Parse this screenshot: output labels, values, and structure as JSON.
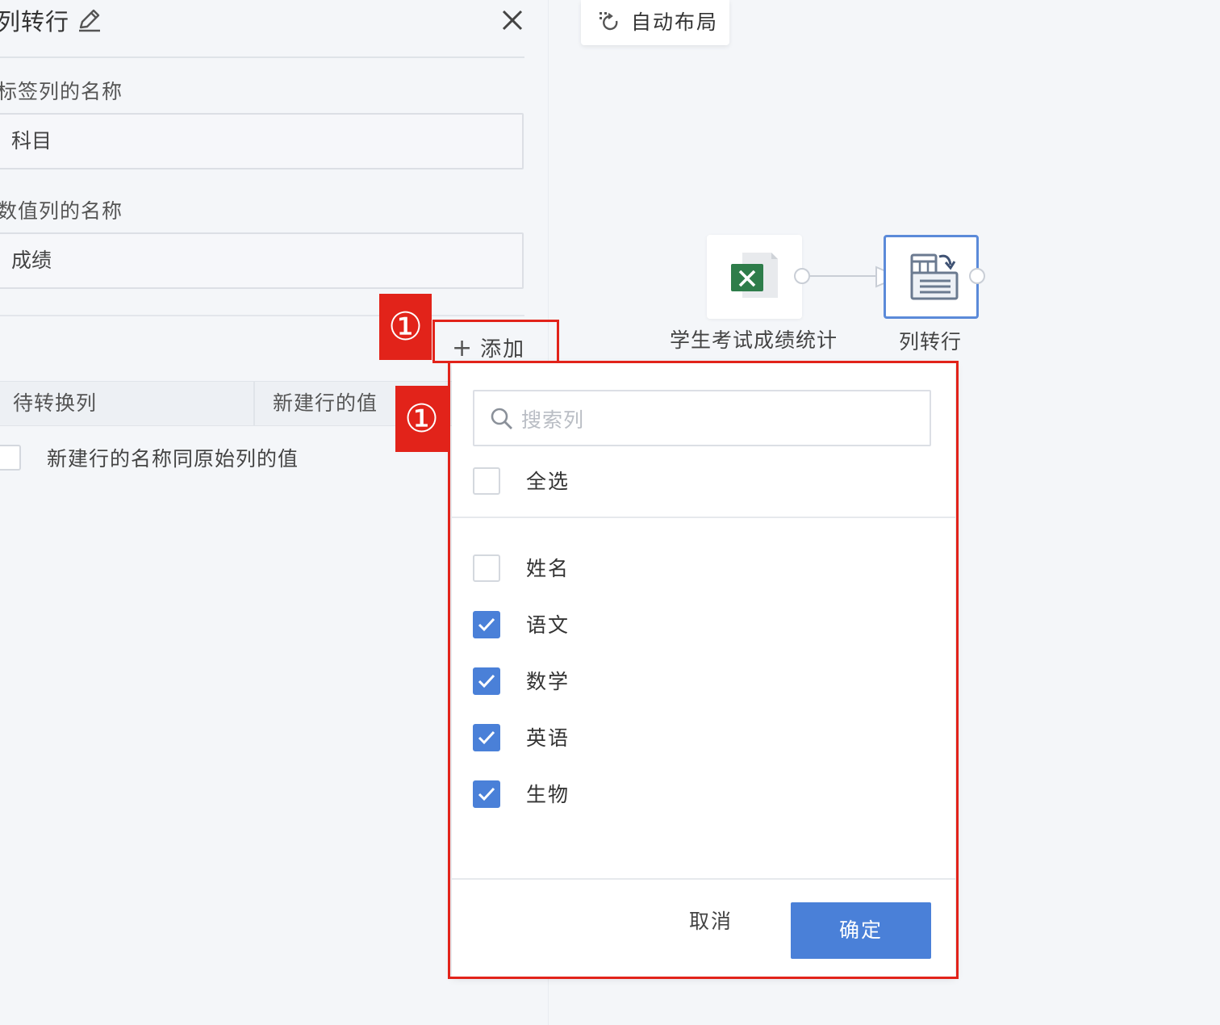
{
  "panel": {
    "title": "列转行",
    "label_column_label": "标签列的名称",
    "label_column_value": "科目",
    "value_column_label": "数值列的名称",
    "value_column_value": "成绩",
    "add_label": "添加",
    "add_plus": "+",
    "table_headers": [
      "待转换列",
      "新建行的值"
    ],
    "option_label": "新建行的名称同原始列的值"
  },
  "canvas": {
    "auto_layout_label": "自动布局",
    "source_node_label": "学生考试成绩统计",
    "target_node_label": "列转行"
  },
  "annotations": {
    "badge_1": "①",
    "badge_2": "①",
    "color": "#e2231a"
  },
  "dropdown": {
    "search_placeholder": "搜索列",
    "select_all_label": "全选",
    "select_all_checked": false,
    "columns": [
      {
        "label": "姓名",
        "checked": false
      },
      {
        "label": "语文",
        "checked": true
      },
      {
        "label": "数学",
        "checked": true
      },
      {
        "label": "英语",
        "checked": true
      },
      {
        "label": "生物",
        "checked": true
      }
    ],
    "cancel_label": "取消",
    "ok_label": "确定",
    "accent_color": "#4a80d8"
  }
}
